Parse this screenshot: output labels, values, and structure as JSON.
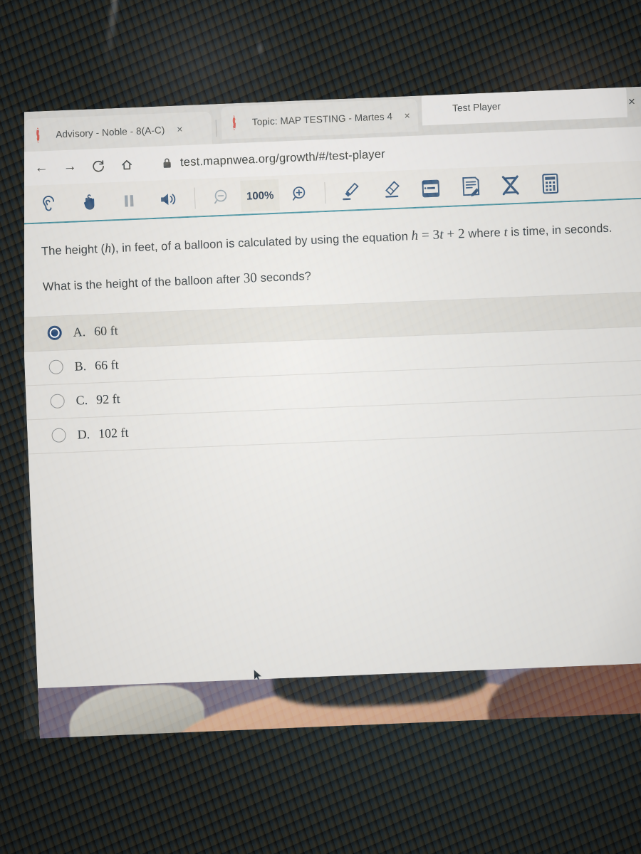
{
  "browser": {
    "tabs": [
      {
        "title": "Advisory - Noble - 8(A-C)",
        "favicon": "red-dashed-circle-icon",
        "active": false,
        "close_label": "×"
      },
      {
        "title": "Topic: MAP TESTING - Martes 4/",
        "favicon": "red-dashed-circle-icon",
        "active": false,
        "close_label": "×"
      },
      {
        "title": "Test Player",
        "favicon": "globe-icon",
        "active": true,
        "close_label": "×"
      }
    ],
    "window_close_label": "×",
    "new_tab_label": "+",
    "nav": {
      "back_label": "←",
      "forward_label": "→",
      "reload_label": "C",
      "home_label": "⌂",
      "lock_icon": "lock-icon",
      "url": "test.mapnwea.org/growth/#/test-player",
      "bookmark_label": "☆"
    }
  },
  "test_toolbar": {
    "buttons": [
      {
        "name": "listen-tool",
        "label": "Listen"
      },
      {
        "name": "pointer-tool",
        "label": "Pointer"
      },
      {
        "name": "pause-tool",
        "label": "Pause"
      },
      {
        "name": "sound-tool",
        "label": "Sound"
      }
    ],
    "zoom_out_label": "−",
    "zoom_level": "100%",
    "zoom_in_label": "+",
    "tools": [
      {
        "name": "highlighter-tool",
        "label": "Highlighter"
      },
      {
        "name": "eraser-tool",
        "label": "Eraser"
      },
      {
        "name": "line-reader-tool",
        "label": "Line Reader"
      },
      {
        "name": "notepad-tool",
        "label": "Notepad"
      },
      {
        "name": "cross-out-tool",
        "label": "Cross Out"
      },
      {
        "name": "calculator-tool",
        "label": "Calculator"
      }
    ],
    "accent_color": "#2a4a74",
    "rule_color": "#3d8b9c"
  },
  "question": {
    "stem_part1": "The height (",
    "stem_var_h": "h",
    "stem_part2": "), in feet, of a balloon is calculated by using the equation ",
    "equation": "h = 3t + 2",
    "equation_h": "h",
    "equation_eq": " = 3",
    "equation_t": "t",
    "equation_tail": " + 2",
    "stem_part3": " where ",
    "stem_var_t": "t",
    "stem_part4": " is time, in seconds.",
    "prompt_part1": "What is the height of the balloon after ",
    "prompt_number": "30",
    "prompt_part2": " seconds?",
    "choices": [
      {
        "letter": "A.",
        "text": "60 ft",
        "selected": true
      },
      {
        "letter": "B.",
        "text": "66 ft",
        "selected": false
      },
      {
        "letter": "C.",
        "text": "92 ft",
        "selected": false
      },
      {
        "letter": "D.",
        "text": "102 ft",
        "selected": false
      }
    ]
  },
  "colors": {
    "page_background": "#eceae6",
    "selected_row": "#dedbd4",
    "radio_selected": "#1d3d6e",
    "toolbar_icon": "#2a4a74",
    "toolbar_rule": "#3d8b9c",
    "tab_active": "#f2f0ee",
    "room": "#060606"
  }
}
